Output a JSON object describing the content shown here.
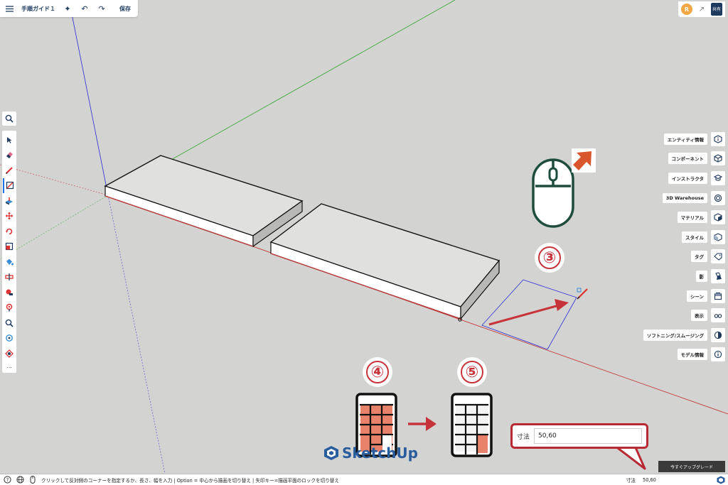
{
  "topbar": {
    "menu_icon": "hamburger-icon",
    "title": "手順ガイド１",
    "sparkle_icon": "ai-sparkle-icon",
    "undo_icon": "undo-icon",
    "redo_icon": "redo-icon",
    "save_label": "保存"
  },
  "topright": {
    "avatar_letter": "R",
    "share_icon": "share-arrow-icon",
    "share_label": "共有"
  },
  "left_toolbar": {
    "search_icon": "search-icon",
    "tools": [
      {
        "name": "select-tool",
        "icon": "arrow-cursor-icon",
        "active": false
      },
      {
        "name": "eraser-tool",
        "icon": "eraser-icon",
        "active": false
      },
      {
        "name": "pencil-tool",
        "icon": "pencil-icon",
        "active": false
      },
      {
        "name": "rectangle-tool",
        "icon": "rectangle-icon",
        "active": true
      },
      {
        "name": "push-pull-tool",
        "icon": "push-pull-icon",
        "active": false
      },
      {
        "name": "move-tool",
        "icon": "move-icon",
        "active": false
      },
      {
        "name": "rotate-tool",
        "icon": "rotate-icon",
        "active": false
      },
      {
        "name": "scale-tool",
        "icon": "scale-icon",
        "active": false
      },
      {
        "name": "paint-bucket-tool",
        "icon": "paint-bucket-icon",
        "active": false
      },
      {
        "name": "offset-tool",
        "icon": "offset-icon",
        "active": false
      },
      {
        "name": "tape-measure-tool",
        "icon": "tape-measure-icon",
        "active": false
      },
      {
        "name": "position-camera-tool",
        "icon": "position-camera-icon",
        "active": false
      },
      {
        "name": "zoom-tool",
        "icon": "magnifier-icon",
        "active": false
      },
      {
        "name": "orbit-tool",
        "icon": "orbit-icon",
        "active": false
      },
      {
        "name": "section-tool",
        "icon": "section-plane-icon",
        "active": false
      }
    ],
    "more_label": "…"
  },
  "right_panels": [
    {
      "label": "エンティティ情報",
      "icon": "entity-info-icon"
    },
    {
      "label": "コンポーネント",
      "icon": "components-icon"
    },
    {
      "label": "インストラクタ",
      "icon": "instructor-icon"
    },
    {
      "label": "3D Warehouse",
      "icon": "warehouse-icon"
    },
    {
      "label": "マテリアル",
      "icon": "materials-icon"
    },
    {
      "label": "スタイル",
      "icon": "styles-icon"
    },
    {
      "label": "タグ",
      "icon": "tag-icon"
    },
    {
      "label": "影",
      "icon": "shadows-icon"
    },
    {
      "label": "シーン",
      "icon": "scenes-icon"
    },
    {
      "label": "表示",
      "icon": "display-icon"
    },
    {
      "label": "ソフトニング/スムージング",
      "icon": "soften-smooth-icon"
    },
    {
      "label": "モデル情報",
      "icon": "model-info-icon"
    }
  ],
  "overlays": {
    "step3": "③",
    "step4": "④",
    "step5": "⑤",
    "mouse_icon": "mouse-icon",
    "keypad_icon": "numeric-keypad-icon"
  },
  "dimension_callout": {
    "label": "寸法",
    "value": "50,60"
  },
  "logo_text": "SketchUp",
  "upgrade_label": "今すぐアップグレード",
  "statusbar": {
    "help_icon": "help-icon",
    "globe_icon": "globe-icon",
    "mouse_icon": "mouse-icon",
    "message": "クリックして反対側のコーナーを指定するか、長さ、幅を入力 | Option = 中心から描画を切り替え | 矢印キー=描画平面のロックを切り替え",
    "dim_label": "寸法",
    "dim_value": "50,60",
    "app_icon": "sketchup-app-icon"
  },
  "colors": {
    "accent_red": "#c7333a",
    "keypad_fill": "#e8826a",
    "navy": "#1f3a5f",
    "mouse_stroke": "#1e4d3e",
    "arrow_orange": "#d9552c"
  }
}
